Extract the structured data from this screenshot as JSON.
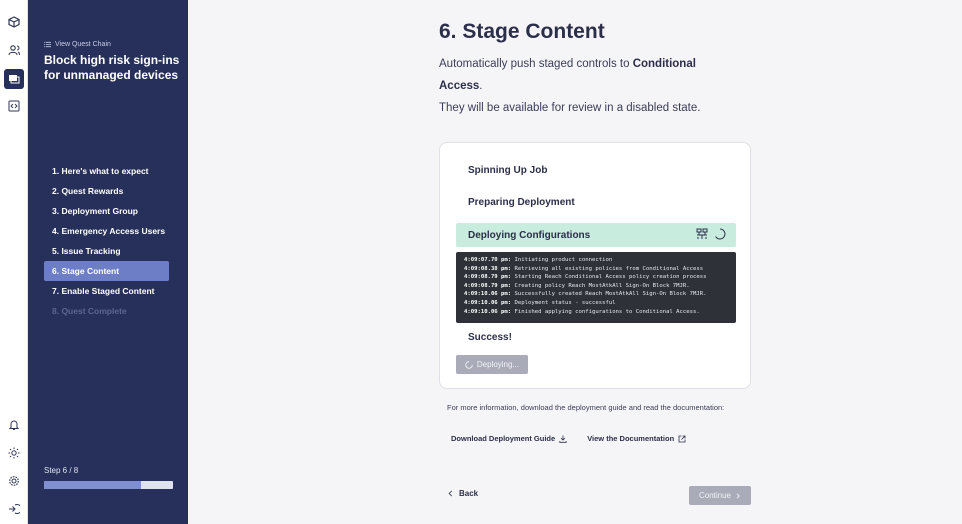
{
  "rail": {
    "icons": [
      "cube-icon",
      "user-icon",
      "quest-icon",
      "code-icon",
      "bell-icon",
      "sun-icon",
      "settings-icon",
      "logout-icon"
    ]
  },
  "nav": {
    "back_label": "View Quest Chain",
    "title": "Block high risk sign-ins for unmanaged devices",
    "steps": [
      {
        "label": "1. Here's what to expect",
        "state": "done"
      },
      {
        "label": "2. Quest Rewards",
        "state": "done"
      },
      {
        "label": "3. Deployment Group",
        "state": "done"
      },
      {
        "label": "4. Emergency Access Users",
        "state": "done"
      },
      {
        "label": "5. Issue Tracking",
        "state": "done"
      },
      {
        "label": "6. Stage Content",
        "state": "active"
      },
      {
        "label": "7. Enable Staged Content",
        "state": "todo"
      },
      {
        "label": "8. Quest Complete",
        "state": "disabled"
      }
    ],
    "step_count": "Step 6 / 8",
    "progress": 0.75
  },
  "main": {
    "title": "6. Stage Content",
    "desc_prefix": "Automatically push staged controls to ",
    "desc_bold": "Conditional Access",
    "desc_suffix": ".",
    "desc_line2": "They will be available for review in a disabled state.",
    "jobs": {
      "spinning": "Spinning Up Job",
      "preparing": "Preparing Deployment",
      "deploying": "Deploying Configurations",
      "success": "Success!"
    },
    "log": [
      {
        "time": "4:09:07.70 pm:",
        "msg": "Initiating product connection"
      },
      {
        "time": "4:09:08.38 pm:",
        "msg": "Retrieving all existing policies from Conditional Access"
      },
      {
        "time": "4:09:08.79 pm:",
        "msg": "Starting Reach Conditional Access policy creation process"
      },
      {
        "time": "4:09:08.79 pm:",
        "msg": "Creating policy Reach MostAtkAll Sign-On Block 7MJR."
      },
      {
        "time": "4:09:10.06 pm:",
        "msg": "Successfully created Reach MostAtkAll Sign-On Block 7MJR."
      },
      {
        "time": "4:09:10.06 pm:",
        "msg": "Deployment status - successful"
      },
      {
        "time": "4:09:10.06 pm:",
        "msg": "Finished applying configurations to Conditional Access."
      }
    ],
    "deploy_button": "Deploying...",
    "more_info": "For more information, download the deployment guide and read the documentation:",
    "download_link": "Download Deployment Guide",
    "docs_link": "View the Documentation",
    "back_label": "Back",
    "continue_label": "Continue"
  }
}
